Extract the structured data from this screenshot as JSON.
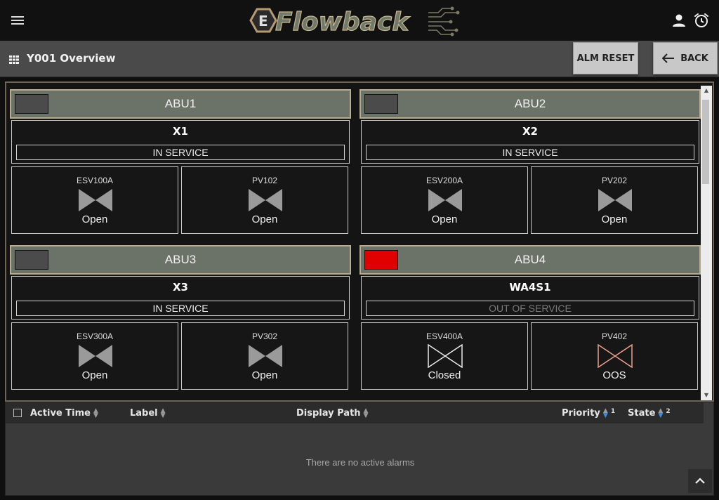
{
  "header": {
    "logo_text": "Flowback",
    "menu_icon": "hamburger-menu-icon",
    "user_icon": "user-icon",
    "alarm_icon": "alarm-clock-icon"
  },
  "titlebar": {
    "title": "Y001 Overview",
    "alm_reset_label": "ALM RESET",
    "back_label": "BACK"
  },
  "colors": {
    "status_normal": "#4b4b4b",
    "status_alarm": "#e00000",
    "valve_open": "#9a9a9a",
    "valve_closed_outline": "#e8e8e8",
    "valve_oos": "#e8a08c",
    "sort_active": "#3d8de0"
  },
  "panels": [
    {
      "name": "ABU1",
      "status": "normal",
      "well": "X1",
      "service": "IN SERVICE",
      "service_active": true,
      "valves": [
        {
          "tag": "ESV100A",
          "state": "Open",
          "kind": "open"
        },
        {
          "tag": "PV102",
          "state": "Open",
          "kind": "open"
        }
      ]
    },
    {
      "name": "ABU2",
      "status": "normal",
      "well": "X2",
      "service": "IN SERVICE",
      "service_active": true,
      "valves": [
        {
          "tag": "ESV200A",
          "state": "Open",
          "kind": "open"
        },
        {
          "tag": "PV202",
          "state": "Open",
          "kind": "open"
        }
      ]
    },
    {
      "name": "ABU3",
      "status": "normal",
      "well": "X3",
      "service": "IN SERVICE",
      "service_active": true,
      "valves": [
        {
          "tag": "ESV300A",
          "state": "Open",
          "kind": "open"
        },
        {
          "tag": "PV302",
          "state": "Open",
          "kind": "open"
        }
      ]
    },
    {
      "name": "ABU4",
      "status": "alarm",
      "well": "WA4S1",
      "service": "OUT OF SERVICE",
      "service_active": false,
      "valves": [
        {
          "tag": "ESV400A",
          "state": "Closed",
          "kind": "closed"
        },
        {
          "tag": "PV402",
          "state": "OOS",
          "kind": "oos"
        }
      ]
    }
  ],
  "alarm_table": {
    "columns": [
      {
        "label": "Active Time",
        "sort": "none",
        "order": ""
      },
      {
        "label": "Label",
        "sort": "none",
        "order": ""
      },
      {
        "label": "Display Path",
        "sort": "none",
        "order": ""
      },
      {
        "label": "Priority",
        "sort": "desc",
        "order": "1"
      },
      {
        "label": "State",
        "sort": "desc",
        "order": "2"
      }
    ],
    "empty_message": "There are no active alarms"
  }
}
